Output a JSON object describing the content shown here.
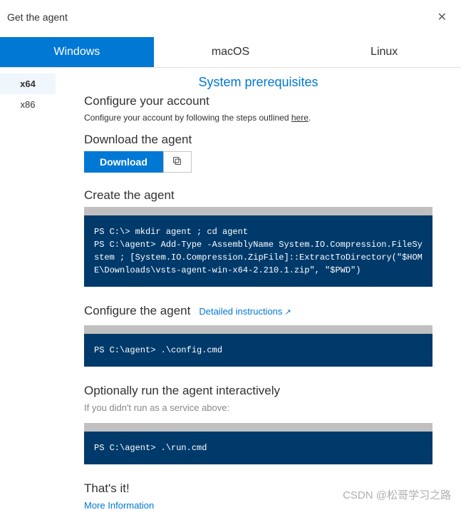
{
  "dialog": {
    "title": "Get the agent"
  },
  "tabs": {
    "os": [
      "Windows",
      "macOS",
      "Linux"
    ],
    "arch": [
      "x64",
      "x86"
    ]
  },
  "content": {
    "prereq_link": "System prerequisites",
    "configure_account": {
      "heading": "Configure your account",
      "text_prefix": "Configure your account by following the steps outlined ",
      "here": "here",
      "text_suffix": "."
    },
    "download_section": {
      "heading": "Download the agent",
      "button": "Download"
    },
    "create": {
      "heading": "Create the agent",
      "code": "PS C:\\> mkdir agent ; cd agent\nPS C:\\agent> Add-Type -AssemblyName System.IO.Compression.FileSystem ; [System.IO.Compression.ZipFile]::ExtractToDirectory(\"$HOME\\Downloads\\vsts-agent-win-x64-2.210.1.zip\", \"$PWD\")"
    },
    "configure": {
      "heading": "Configure the agent",
      "detail": "Detailed instructions",
      "code": "PS C:\\agent> .\\config.cmd"
    },
    "run": {
      "heading": "Optionally run the agent interactively",
      "note": "If you didn't run as a service above:",
      "code": "PS C:\\agent> .\\run.cmd"
    },
    "done": {
      "heading": "That's it!",
      "more": "More Information"
    }
  },
  "watermark": "CSDN @松哥学习之路"
}
